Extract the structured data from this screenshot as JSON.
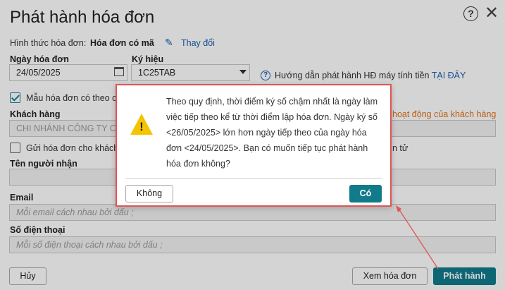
{
  "dialog": {
    "title": "Phát hành hóa đơn",
    "invoice_form_label": "Hình thức hóa đơn:",
    "invoice_form_value": "Hóa đơn có mã",
    "change_link": "Thay đổi"
  },
  "form": {
    "date_label": "Ngày hóa đơn",
    "date_value": "24/05/2025",
    "symbol_label": "Ký hiệu",
    "symbol_value": "1C25TAB",
    "guide_text": "Hướng dẫn phát hành HĐ máy tính tiền",
    "guide_link": "TẠI ĐÂY",
    "template_checkbox_label": "Mẫu hóa đơn có theo c",
    "customer_label": "Khách hàng",
    "customer_value": "CHI NHÁNH CÔNG TY CA",
    "customer_activity_link": "hoạt động của khách hàng",
    "send_invoice_label": "Gửi hóa đơn cho khách",
    "send_invoice_suffix": "n tử",
    "recipient_label": "Tên người nhận",
    "email_label": "Email",
    "email_placeholder": "Mỗi email cách nhau bởi dấu ;",
    "phone_label": "Số điện thoại",
    "phone_placeholder": "Mỗi số điện thoại cách nhau bởi dấu ;"
  },
  "footer": {
    "cancel_label": "Hủy",
    "view_label": "Xem hóa đơn",
    "issue_label": "Phát hành"
  },
  "alert": {
    "message": "Theo quy định, thời điểm ký số chậm nhất là ngày làm việc tiếp theo kể từ thời điểm lập hóa đơn. Ngày ký số <26/05/2025> lớn hơn ngày tiếp theo của ngày hóa đơn <24/05/2025>. Bạn có muốn tiếp tục phát hành hóa đơn không?",
    "no_label": "Không",
    "yes_label": "Có"
  },
  "colors": {
    "primary": "#117a8b",
    "link": "#1a5fb4",
    "warning": "#f5c400",
    "highlight": "#e05555",
    "activity_link": "#e0731a"
  },
  "icons": {
    "help": "question-circle-icon",
    "close": "close-icon",
    "edit": "pencil-icon",
    "calendar": "calendar-icon",
    "dropdown": "chevron-down-icon",
    "info": "info-circle-icon",
    "warning": "warning-triangle-icon"
  }
}
